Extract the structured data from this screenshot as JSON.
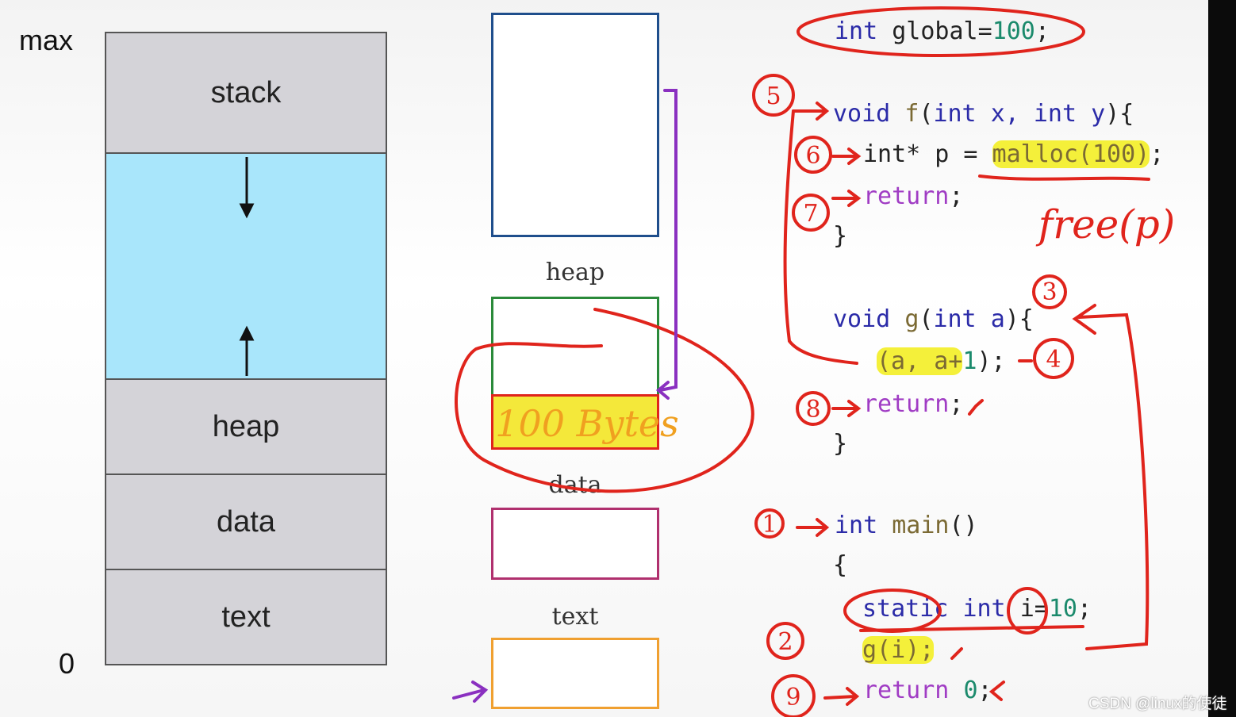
{
  "left_diagram": {
    "max_label": "max",
    "zero_label": "0",
    "segments": [
      {
        "label": "stack"
      },
      {
        "label": ""
      },
      {
        "label": "heap"
      },
      {
        "label": "data"
      },
      {
        "label": "text"
      }
    ],
    "colors": {
      "segment": "#d4d3d8",
      "free_space": "#a9e6fb"
    }
  },
  "middle_diagram": {
    "heap_label": "heap",
    "data_label": "data",
    "text_label": "text",
    "colors": {
      "stack_box": "#1f4e8c",
      "heap_box": "#2a8a3a",
      "data_box": "#b0306e",
      "text_box": "#f0a030",
      "highlight": "#f4f03a"
    }
  },
  "code": [
    [
      [
        "int ",
        "kw"
      ],
      [
        "global=",
        "pl"
      ],
      [
        "100",
        "num"
      ],
      [
        ";",
        "pl"
      ]
    ],
    [
      [
        "void ",
        "kw"
      ],
      [
        "f",
        "fn"
      ],
      [
        "(",
        "pl"
      ],
      [
        "int ",
        "kw"
      ],
      [
        "x, ",
        "kw"
      ],
      [
        "int ",
        "kw"
      ],
      [
        "y",
        "kw"
      ],
      [
        "){",
        "pl"
      ]
    ],
    [
      [
        "int* p = ",
        "pl"
      ],
      [
        "malloc(100)",
        "fn"
      ],
      [
        ";",
        "pl"
      ]
    ],
    [
      [
        "return",
        "ret"
      ],
      [
        ";",
        "pl"
      ]
    ],
    [
      [
        "}",
        "pl"
      ]
    ],
    [
      [
        "void ",
        "kw"
      ],
      [
        "g",
        "fn"
      ],
      [
        "(",
        "pl"
      ],
      [
        "int ",
        "kw"
      ],
      [
        "a",
        "kw"
      ],
      [
        "){",
        "pl"
      ]
    ],
    [
      [
        "(a, a+",
        "fn"
      ],
      [
        "1",
        "num"
      ],
      [
        ");",
        "pl"
      ]
    ],
    [
      [
        "return",
        "ret"
      ],
      [
        ";",
        "pl"
      ]
    ],
    [
      [
        "}",
        "pl"
      ]
    ],
    [
      [
        "int ",
        "kw"
      ],
      [
        "main",
        "fn"
      ],
      [
        "()",
        "pl"
      ]
    ],
    [
      [
        "{",
        "pl"
      ]
    ],
    [
      [
        "static ",
        "kw"
      ],
      [
        "int ",
        "kw"
      ],
      [
        "i=",
        "pl"
      ],
      [
        "10",
        "num"
      ],
      [
        ";",
        "pl"
      ]
    ],
    [
      [
        "g(i);",
        "fn"
      ]
    ],
    [
      [
        "return ",
        "ret"
      ],
      [
        "0",
        "num"
      ],
      [
        ";",
        "pl"
      ]
    ]
  ],
  "annotations": {
    "heap_note": "100 Bytes",
    "free_note": "free(p)",
    "step_numbers": [
      "1",
      "2",
      "3",
      "4",
      "5",
      "6",
      "7",
      "8",
      "9"
    ],
    "ink_color": "#e0241c"
  },
  "watermark": "CSDN @linux的使徒"
}
